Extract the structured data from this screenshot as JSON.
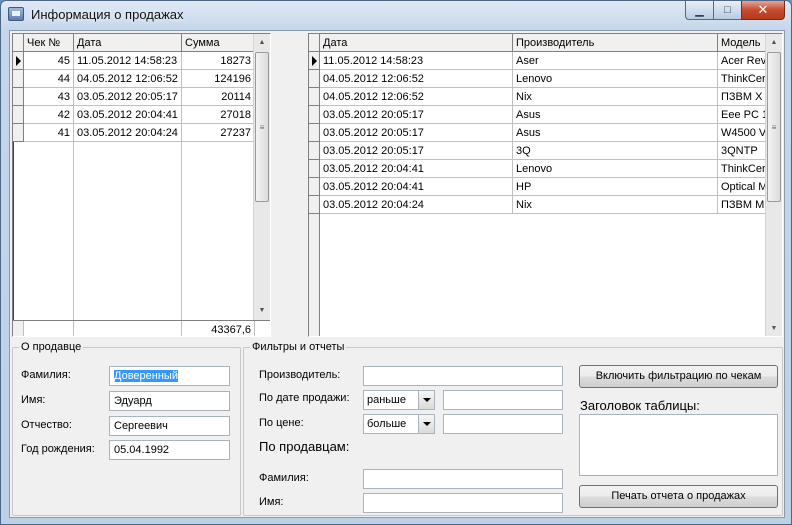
{
  "window": {
    "title": "Информация о продажах",
    "min_glyph": "▁",
    "max_glyph": "□",
    "close_glyph": "✕"
  },
  "checks_grid": {
    "columns": [
      "Чек №",
      "Дата",
      "Сумма"
    ],
    "rows": [
      [
        "45",
        "11.05.2012 14:58:23",
        "18273"
      ],
      [
        "44",
        "04.05.2012 12:06:52",
        "124196"
      ],
      [
        "43",
        "03.05.2012 20:05:17",
        "20114"
      ],
      [
        "42",
        "03.05.2012 20:04:41",
        "27018"
      ],
      [
        "41",
        "03.05.2012 20:04:24",
        "27237"
      ]
    ],
    "footer_sum": "43367,6"
  },
  "items_grid": {
    "columns": [
      "Дата",
      "Производитель",
      "Модель"
    ],
    "rows": [
      [
        "11.05.2012 14:58:23",
        "Aser",
        "Acer Rev"
      ],
      [
        "04.05.2012 12:06:52",
        "Lenovo",
        "ThinkCer"
      ],
      [
        "04.05.2012 12:06:52",
        "Nix",
        "ПЗВМ Х"
      ],
      [
        "03.05.2012 20:05:17",
        "Asus",
        "Eee PC 1"
      ],
      [
        "03.05.2012 20:05:17",
        "Asus",
        "W4500 V"
      ],
      [
        "03.05.2012 20:05:17",
        "3Q",
        "3QNTP"
      ],
      [
        "03.05.2012 20:04:41",
        "Lenovo",
        "ThinkCer"
      ],
      [
        "03.05.2012 20:04:41",
        "HP",
        "Optical M"
      ],
      [
        "03.05.2012 20:04:24",
        "Nix",
        "ПЗВМ М"
      ]
    ]
  },
  "seller": {
    "legend": "О продавце",
    "surname_label": "Фамилия:",
    "surname_value": "Доверенный",
    "name_label": "Имя:",
    "name_value": "Эдуард",
    "patronymic_label": "Отчество:",
    "patronymic_value": "Сергеевич",
    "birth_label": "Год рождения:",
    "birth_value": "05.04.1992"
  },
  "filters": {
    "legend": "Фильтры и отчеты",
    "manufacturer_label": "Производитель:",
    "date_label": "По дате продажи:",
    "date_op": "раньше",
    "price_label": "По цене:",
    "price_op": "больше",
    "by_seller_label": "По продавцам:",
    "surname_label": "Фамилия:",
    "name_label": "Имя:",
    "enable_filter_button": "Включить фильтрацию по чекам",
    "table_title_label": "Заголовок таблицы:",
    "print_report_button": "Печать отчета о продажах"
  }
}
